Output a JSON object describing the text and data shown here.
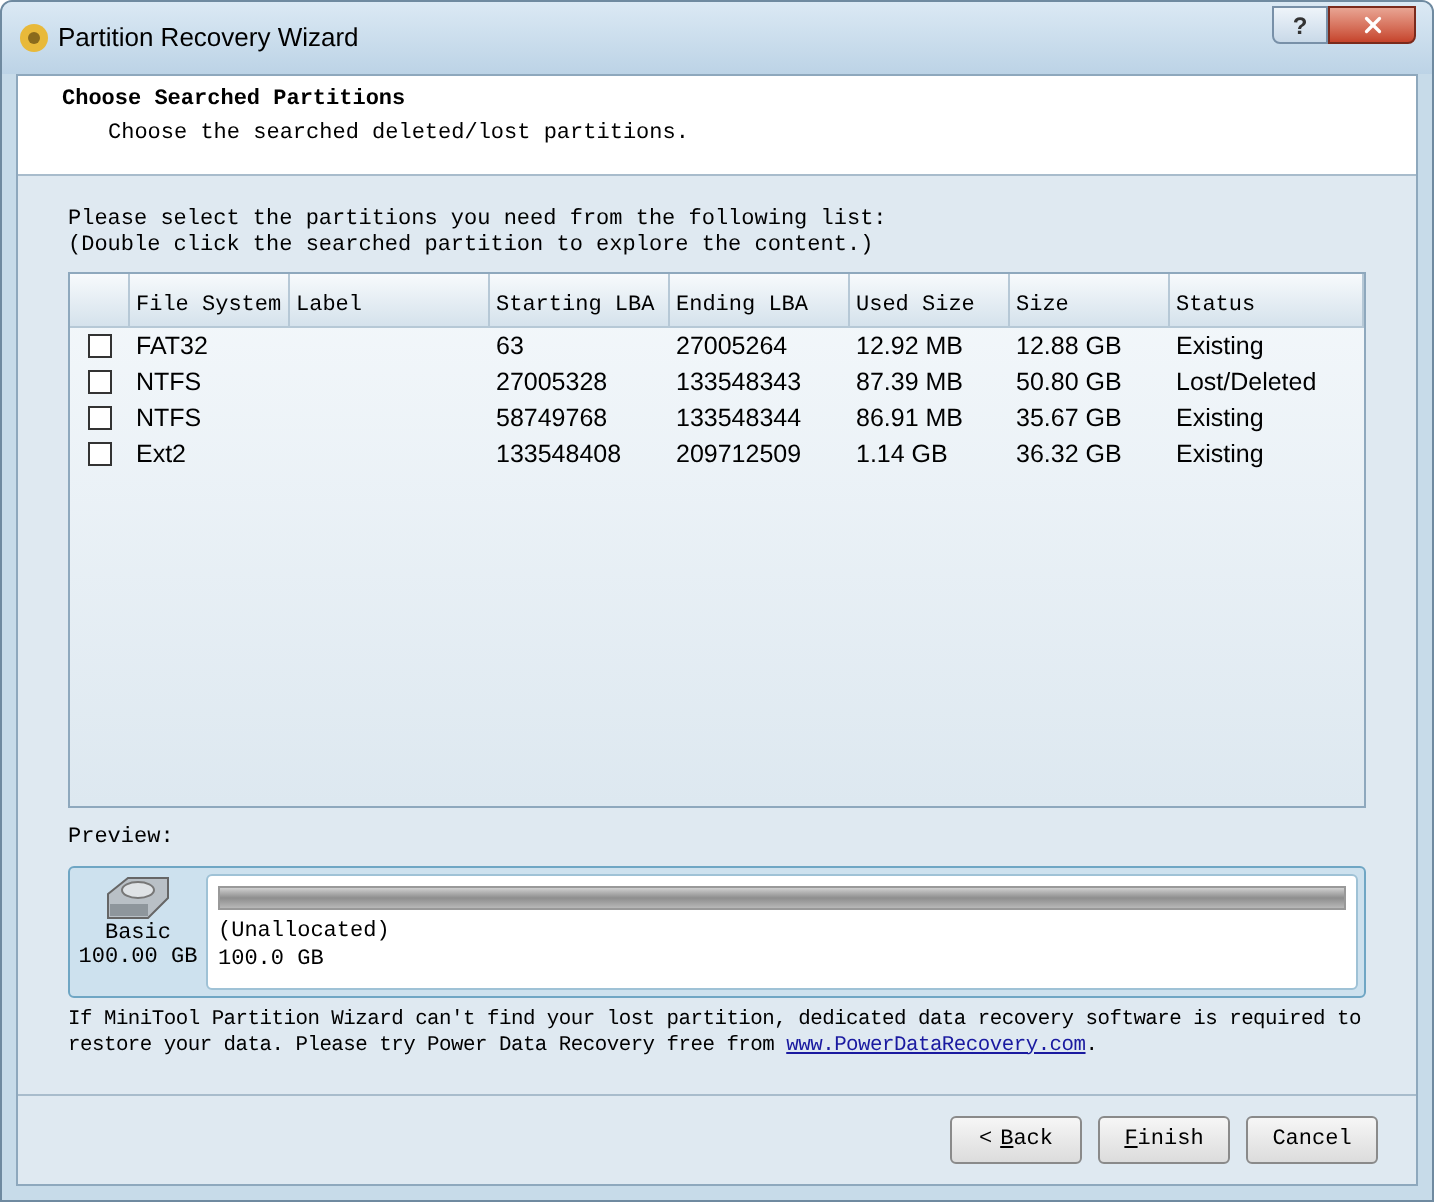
{
  "window": {
    "title": "Partition Recovery Wizard",
    "help": "?"
  },
  "header": {
    "title": "Choose Searched Partitions",
    "subtitle": "Choose the searched deleted/lost partitions."
  },
  "instructions": [
    "Please select the partitions you need from the following list:",
    "(Double click the searched partition to explore the content.)"
  ],
  "table": {
    "columns": [
      "File System",
      "Label",
      "Starting LBA",
      "Ending LBA",
      "Used Size",
      "Size",
      "Status"
    ],
    "rows": [
      {
        "checked": false,
        "cells": [
          "FAT32",
          "",
          "63",
          "27005264",
          "12.92 MB",
          "12.88 GB",
          "Existing"
        ]
      },
      {
        "checked": false,
        "cells": [
          "NTFS",
          "",
          "27005328",
          "133548343",
          "87.39 MB",
          "50.80 GB",
          "Lost/Deleted"
        ]
      },
      {
        "checked": false,
        "cells": [
          "NTFS",
          "",
          "58749768",
          "133548344",
          "86.91 MB",
          "35.67 GB",
          "Existing"
        ]
      },
      {
        "checked": false,
        "cells": [
          "Ext2",
          "",
          "133548408",
          "209712509",
          "1.14 GB",
          "36.32 GB",
          "Existing"
        ]
      }
    ]
  },
  "preview": {
    "label": "Preview:",
    "disk_type": "Basic",
    "disk_size": "100.00 GB",
    "partition_name": "(Unallocated)",
    "partition_size": "100.0 GB"
  },
  "notice": {
    "text": "If MiniTool Partition Wizard can't find your lost partition, dedicated data recovery software is required to restore your data. Please try Power Data Recovery free from ",
    "link": "www.PowerDataRecovery.com",
    "end": "."
  },
  "buttons": [
    {
      "prefix": "<",
      "label": "Back",
      "mnemonic": true
    },
    {
      "label": "Finish",
      "mnemonic": true
    },
    {
      "label": "Cancel",
      "mnemonic": false
    }
  ]
}
